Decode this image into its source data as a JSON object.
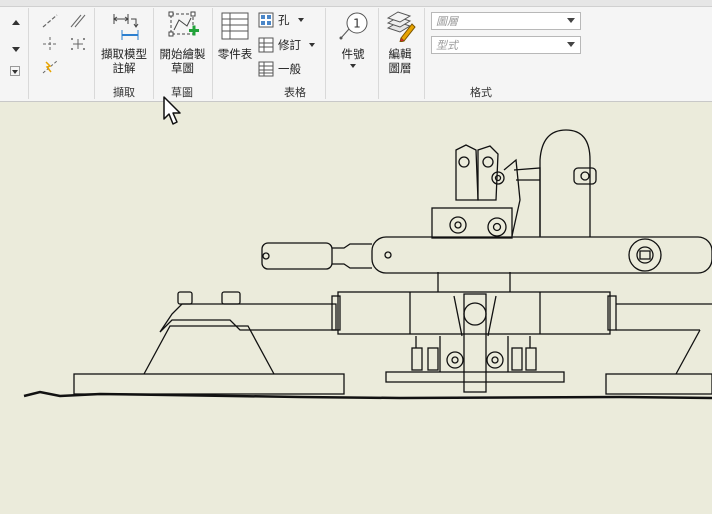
{
  "ribbon": {
    "panels": {
      "extract": "擷取",
      "sketch": "草圖",
      "table": "表格",
      "format": "格式"
    },
    "buttons": {
      "retrieve_annotation": "擷取模型\n註解",
      "start_sketch": "開始繪製\n草圖",
      "parts_list": "零件表",
      "hole": "孔",
      "revision": "修訂",
      "general": "一般",
      "balloon": "件號",
      "edit_layers": "編輯\n圖層"
    },
    "dropdowns": {
      "layer_placeholder": "圖層",
      "style_placeholder": "型式"
    },
    "balloon_number": "1"
  },
  "canvas": {
    "background_color": "#ebebdb",
    "line_color": "#111111"
  }
}
